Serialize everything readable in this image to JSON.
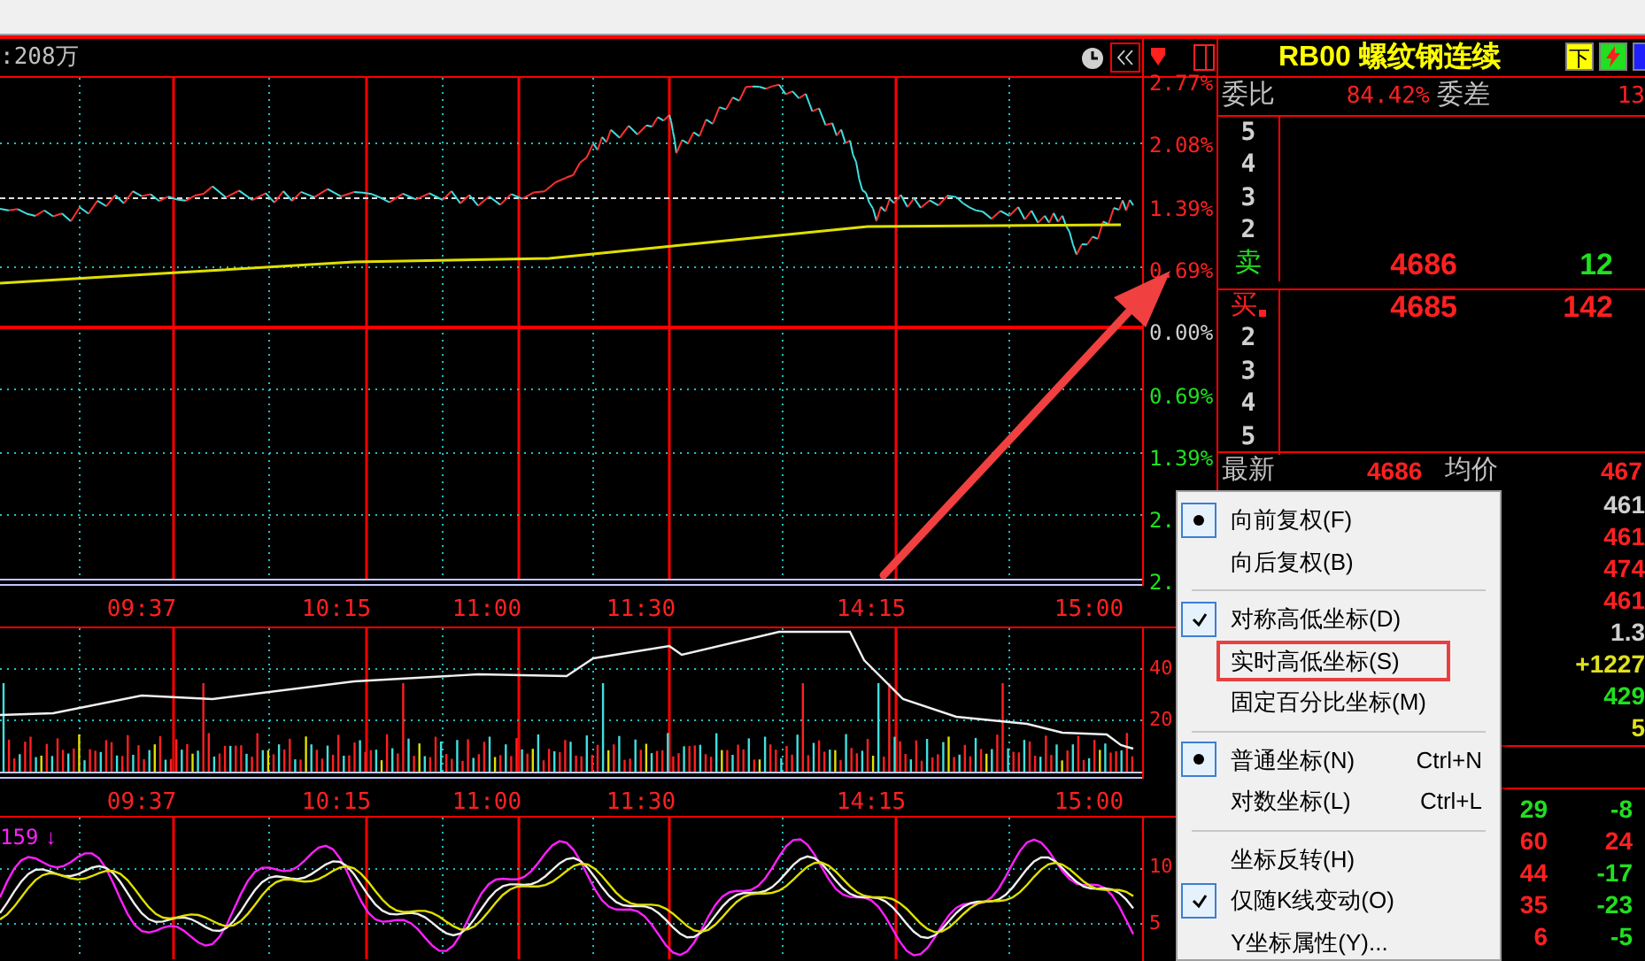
{
  "chart_header": {
    "volume_label": ":208万"
  },
  "price_axis": [
    {
      "label": "2.77%",
      "rise": true,
      "fall": false
    },
    {
      "label": "2.08%",
      "rise": true,
      "fall": false
    },
    {
      "label": "1.39%",
      "rise": true,
      "fall": false
    },
    {
      "label": "0.69%",
      "rise": true,
      "fall": false
    },
    {
      "label": "0.00%",
      "rise": false,
      "fall": false
    },
    {
      "label": "0.69%",
      "rise": false,
      "fall": true
    },
    {
      "label": "1.39%",
      "rise": false,
      "fall": true
    },
    {
      "label": "2.",
      "rise": false,
      "fall": true
    },
    {
      "label": "2.",
      "rise": false,
      "fall": true
    }
  ],
  "time_axis_top": [
    "09:37",
    "10:15",
    "11:00",
    "11:30",
    "14:15",
    "15:00"
  ],
  "volume_axis": [
    "40",
    "20"
  ],
  "time_axis_bottom": [
    "09:37",
    "10:15",
    "11:00",
    "11:30",
    "14:15",
    "15:00"
  ],
  "indicator": {
    "label": "159",
    "arrow": "↓",
    "axis": [
      "10",
      "5"
    ]
  },
  "quote": {
    "code": "RB00",
    "name": "螺纹钢连续",
    "buttons": [
      {
        "label": "下",
        "kind": "text"
      },
      {
        "kind": "flash"
      },
      {
        "kind": "blue"
      }
    ]
  },
  "ratio": {
    "label": "委比",
    "value": "84.42%",
    "diff_label": "委差",
    "diff_value": "13"
  },
  "asks": [
    {
      "level": "5"
    },
    {
      "level": "4"
    },
    {
      "level": "3"
    },
    {
      "level": "2"
    },
    {
      "level": "卖",
      "price": "4686",
      "volume": "12"
    }
  ],
  "bids": [
    {
      "level": "买",
      "price": "4685",
      "volume": "142",
      "selected": true
    },
    {
      "level": "2",
      "selected": false
    },
    {
      "level": "3",
      "selected": false
    },
    {
      "level": "4",
      "selected": false
    },
    {
      "level": "5",
      "selected": false
    }
  ],
  "last": {
    "label": "最新",
    "value": "4686",
    "avg_label": "均价",
    "avg_value": "467"
  },
  "stats": [
    {
      "value": "461",
      "rise": false,
      "fall": false,
      "emphasis": false
    },
    {
      "value": "461",
      "rise": true,
      "fall": false,
      "emphasis": false
    },
    {
      "value": "474",
      "rise": true,
      "fall": false,
      "emphasis": false
    },
    {
      "value": "461",
      "rise": true,
      "fall": false,
      "emphasis": false
    },
    {
      "value": "1.3",
      "rise": false,
      "fall": false,
      "emphasis": false
    },
    {
      "value": "+1227",
      "rise": false,
      "fall": false,
      "emphasis": true
    },
    {
      "value": "429",
      "rise": false,
      "fall": true,
      "emphasis": false
    },
    {
      "value": "5",
      "rise": false,
      "fall": false,
      "emphasis": true
    }
  ],
  "ticks": [
    {
      "volume": "29",
      "volume_rise": false,
      "change": "-8",
      "change_rise": false
    },
    {
      "volume": "60",
      "volume_rise": true,
      "change": "24",
      "change_rise": true
    },
    {
      "volume": "44",
      "volume_rise": true,
      "change": "-17",
      "change_rise": false
    },
    {
      "volume": "35",
      "volume_rise": true,
      "change": "-23",
      "change_rise": false
    },
    {
      "volume": "6",
      "volume_rise": true,
      "change": "-5",
      "change_rise": false
    }
  ],
  "context_menu": {
    "items": [
      {
        "kind": "radio",
        "label": "向前复权(F)",
        "checked": true,
        "highlighted": false
      },
      {
        "kind": "radio",
        "label": "向后复权(B)",
        "checked": false,
        "highlighted": false
      },
      {
        "kind": "separator"
      },
      {
        "kind": "check",
        "label": "对称高低坐标(D)",
        "checked": true,
        "highlighted": false
      },
      {
        "kind": "check",
        "label": "实时高低坐标(S)",
        "checked": false,
        "highlighted": true
      },
      {
        "kind": "check",
        "label": "固定百分比坐标(M)",
        "checked": false,
        "highlighted": false
      },
      {
        "kind": "separator"
      },
      {
        "kind": "radio",
        "label": "普通坐标(N)",
        "checked": true,
        "shortcut": "Ctrl+N",
        "highlighted": false
      },
      {
        "kind": "radio",
        "label": "对数坐标(L)",
        "checked": false,
        "shortcut": "Ctrl+L",
        "highlighted": false
      },
      {
        "kind": "separator"
      },
      {
        "kind": "check",
        "label": "坐标反转(H)",
        "checked": false,
        "highlighted": false
      },
      {
        "kind": "check",
        "label": "仅随K线变动(O)",
        "checked": true,
        "highlighted": false
      },
      {
        "kind": "check",
        "label": "Y坐标属性(Y)...",
        "checked": false,
        "highlighted": false
      }
    ]
  },
  "arrow_annotation": true
}
